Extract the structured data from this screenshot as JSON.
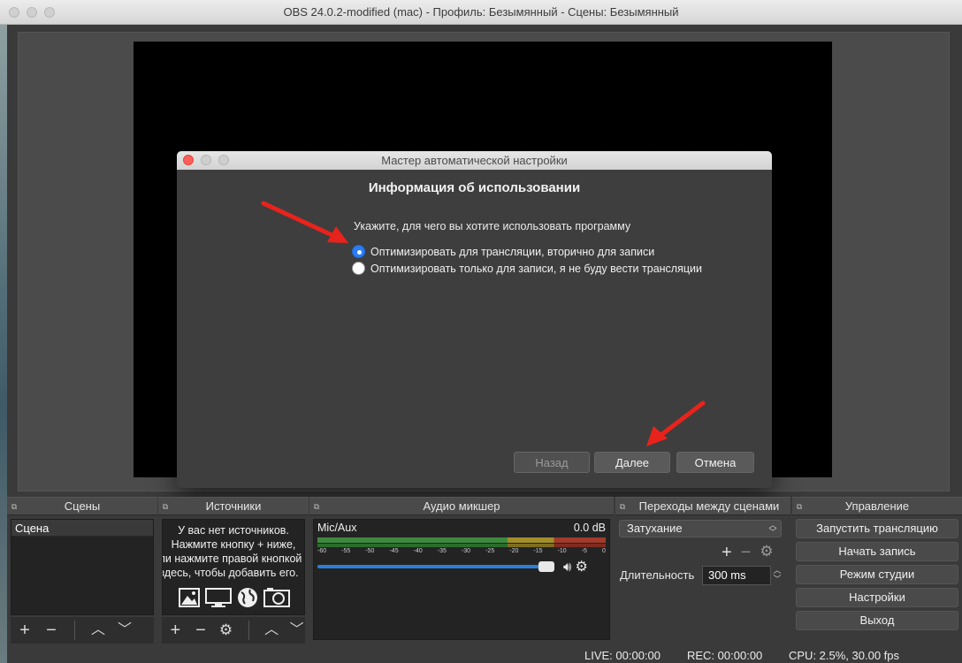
{
  "window": {
    "title": "OBS 24.0.2-modified (mac) - Профиль: Безымянный - Сцены: Безымянный"
  },
  "dialog": {
    "title": "Мастер автоматической настройки",
    "heading": "Информация об использовании",
    "description": "Укажите, для чего вы хотите использовать программу",
    "options": [
      {
        "label": "Оптимизировать для трансляции, вторично для записи",
        "selected": true
      },
      {
        "label": "Оптимизировать только для записи, я не буду вести трансляции",
        "selected": false
      }
    ],
    "buttons": {
      "back": "Назад",
      "next": "Далее",
      "cancel": "Отмена"
    }
  },
  "docks": {
    "scenes": {
      "title": "Сцены",
      "items": [
        "Сцена"
      ]
    },
    "sources": {
      "title": "Источники",
      "empty_lines": [
        "У вас нет источников.",
        "Нажмите кнопку + ниже,",
        "или нажмите правой кнопкой",
        "здесь, чтобы добавить его."
      ]
    },
    "mixer": {
      "title": "Аудио микшер",
      "channel": "Mic/Aux",
      "level": "0.0 dB",
      "ticks": [
        "-60",
        "-55",
        "-50",
        "-45",
        "-40",
        "-35",
        "-30",
        "-25",
        "-20",
        "-15",
        "-10",
        "-5",
        "0"
      ],
      "volume": 1.0
    },
    "transitions": {
      "title": "Переходы между сценами",
      "selected": "Затухание",
      "duration_label": "Длительность",
      "duration_value": "300 ms"
    },
    "controls": {
      "title": "Управление",
      "buttons": [
        "Запустить трансляцию",
        "Начать запись",
        "Режим студии",
        "Настройки",
        "Выход"
      ]
    }
  },
  "status": {
    "live": "LIVE: 00:00:00",
    "rec": "REC: 00:00:00",
    "cpu": "CPU: 2.5%, 30.00 fps"
  },
  "colors": {
    "accent": "#2a7cf7",
    "arrow": "#e8231c",
    "close_button": "#fc5f57"
  }
}
